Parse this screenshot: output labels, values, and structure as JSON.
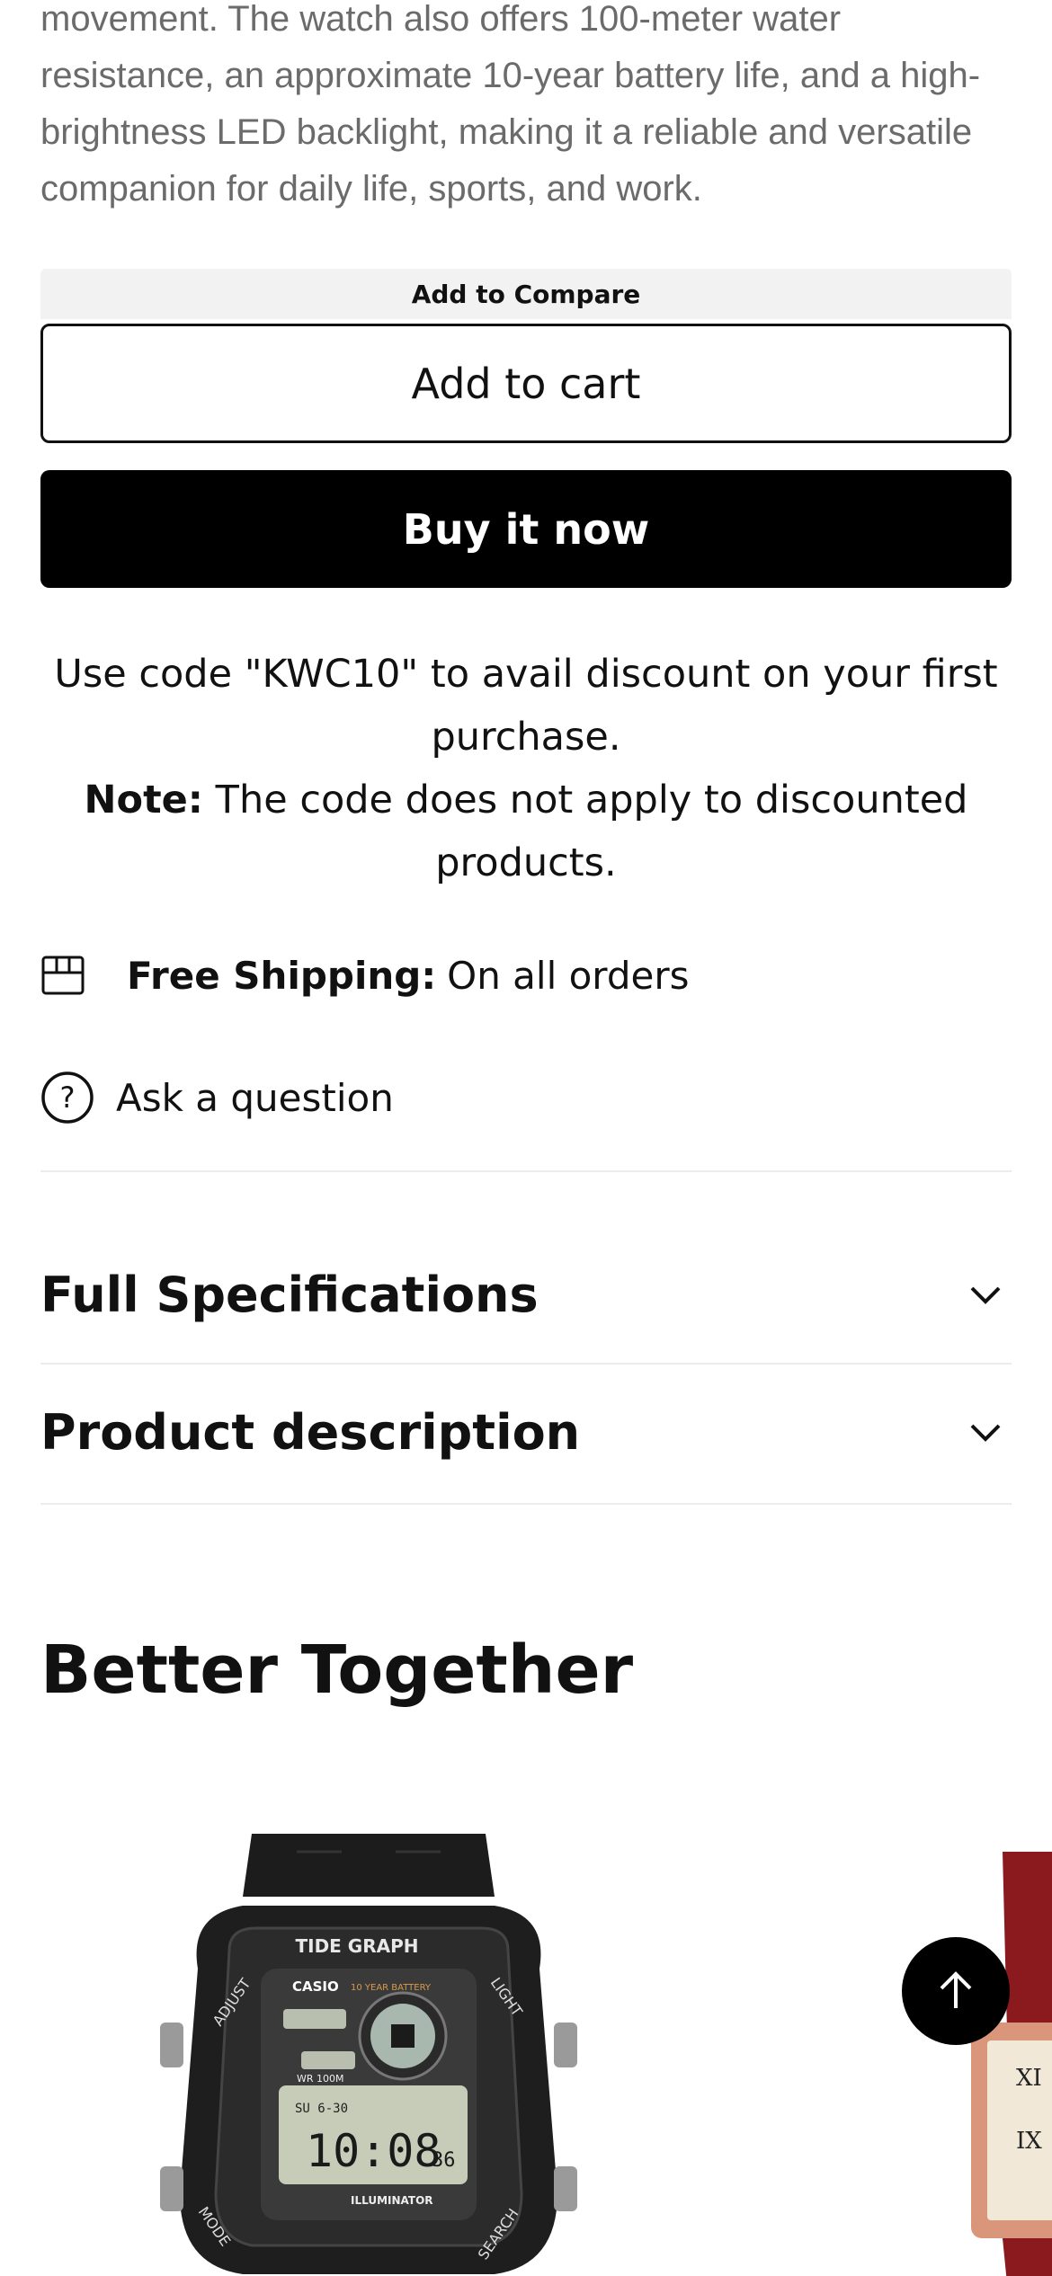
{
  "description": {
    "text": "movement. The watch also offers 100-meter water resistance, an approximate 10-year battery life, and a high-brightness LED backlight, making it a reliable and versatile companion for daily life, sports, and work."
  },
  "actions": {
    "compare_label": "Add to Compare",
    "cart_label": "Add to cart",
    "buy_label": "Buy it now"
  },
  "promo": {
    "line1": "Use code \"KWC10\" to avail discount on your first purchase.",
    "note_label": "Note:",
    "note_text": "The code does not apply to discounted products."
  },
  "shipping": {
    "icon": "box-icon",
    "label": "Free Shipping:",
    "text": "On all orders"
  },
  "ask": {
    "icon": "question-circle-icon",
    "label": "Ask a question"
  },
  "accordions": [
    {
      "title": "Full Specifications",
      "icon": "chevron-down-icon"
    },
    {
      "title": "Product description",
      "icon": "chevron-down-icon"
    }
  ],
  "related": {
    "title": "Better Together",
    "watch1": {
      "top_label": "TIDE GRAPH",
      "brand": "CASIO",
      "battery": "10 YEAR BATTERY",
      "left_label": "ADJUST",
      "right_label": "LIGHT",
      "bottom_left_label": "MODE",
      "bottom_right_label": "SEARCH",
      "display_time": "10:08",
      "display_seconds": "36",
      "display_date": "SU 6-30",
      "illuminator": "ILLUMINATOR",
      "wr": "WR 100M"
    }
  },
  "scroll_top": {
    "icon": "arrow-up-icon"
  }
}
